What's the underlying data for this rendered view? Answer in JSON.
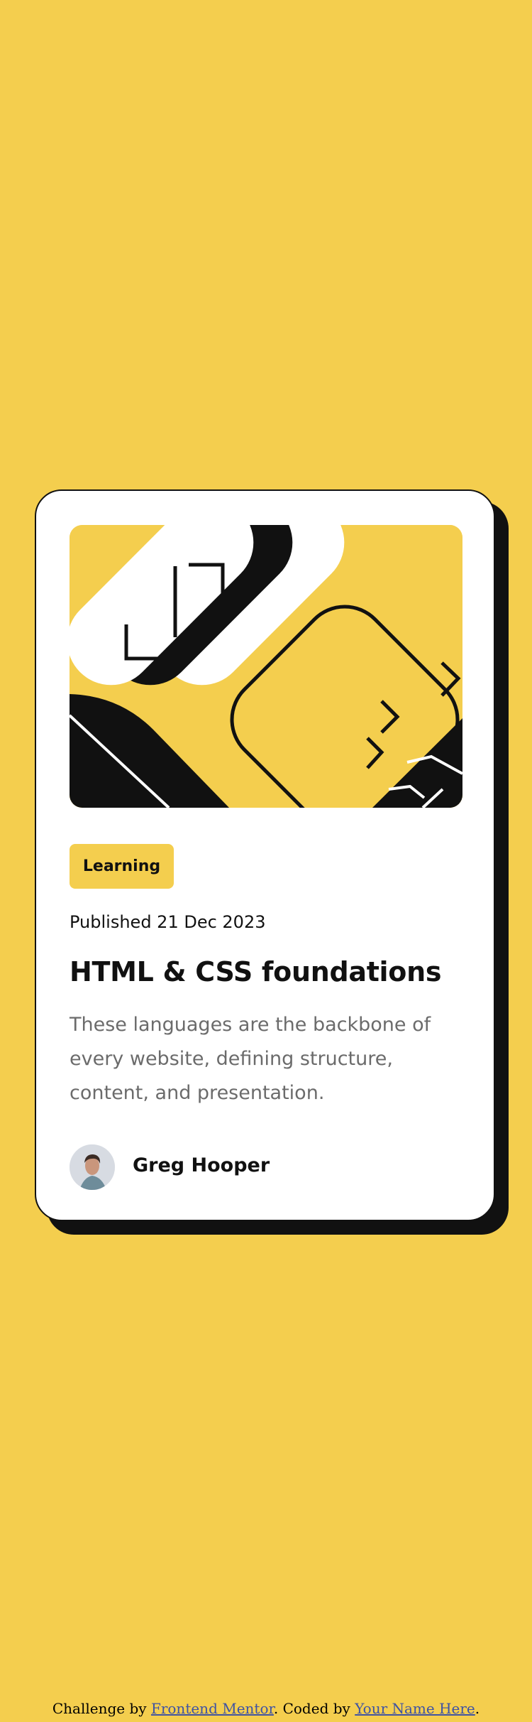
{
  "card": {
    "tag": "Learning",
    "published": "Published 21 Dec 2023",
    "title": "HTML & CSS foundations",
    "description": "These languages are the backbone of every website, defining structure, content, and presentation.",
    "author": "Greg Hooper"
  },
  "footer": {
    "prefix": "Challenge by ",
    "challenge_link": "Frontend Mentor",
    "middle": ". Coded by ",
    "author_link": "Your Name Here",
    "suffix": "."
  },
  "colors": {
    "background": "#F4CE4E",
    "card": "#FFFFFF",
    "ink": "#111111",
    "muted": "#6B6B6B"
  }
}
